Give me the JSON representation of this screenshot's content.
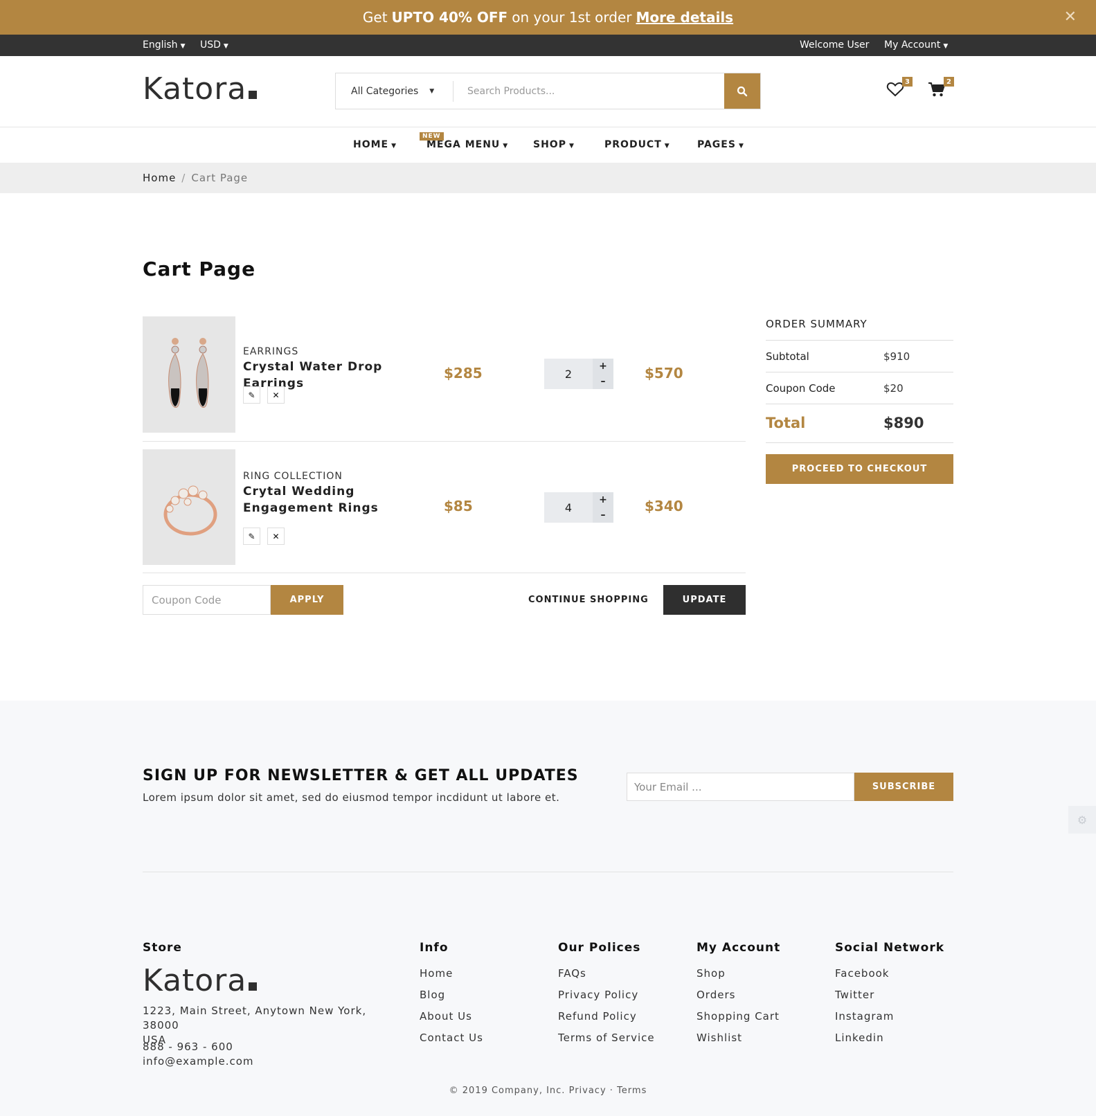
{
  "colors": {
    "accent": "#b38641",
    "dark": "#333333",
    "footer_bg": "#f7f8fa"
  },
  "promo": {
    "text_a": "Get",
    "bold": "UPTO 40% OFF",
    "text_b": "on your 1st order",
    "link": "More details",
    "close_icon": "close-icon"
  },
  "topbar": {
    "language": "English",
    "currency": "USD",
    "welcome": "Welcome User",
    "account": "My Account"
  },
  "header": {
    "logo": "Katora",
    "category": "All Categories",
    "search_placeholder": "Search Products...",
    "wishlist_count": "3",
    "cart_count": "2"
  },
  "nav": {
    "items": [
      "HOME",
      "MEGA MENU",
      "SHOP",
      "PRODUCT",
      "PAGES"
    ],
    "new_tag": "NEW"
  },
  "breadcrumb": {
    "home": "Home",
    "separator": "/",
    "current": "Cart Page"
  },
  "cart": {
    "title": "Cart Page",
    "items": [
      {
        "category": "EARRINGS",
        "name": "Crystal Water Drop Earrings",
        "price": "$285",
        "qty": "2",
        "total": "$570"
      },
      {
        "category": "RING COLLECTION",
        "name": "Crytal Wedding Engagement Rings",
        "price": "$85",
        "qty": "4",
        "total": "$340"
      }
    ],
    "qty_plus": "+",
    "qty_minus": "–",
    "coupon_placeholder": "Coupon Code",
    "apply": "APPLY",
    "continue": "CONTINUE SHOPPING",
    "update": "UPDATE"
  },
  "summary": {
    "title": "ORDER SUMMARY",
    "subtotal_label": "Subtotal",
    "subtotal": "$910",
    "coupon_label": "Coupon Code",
    "coupon": "$20",
    "total_label": "Total",
    "total": "$890",
    "checkout": "PROCEED TO CHECKOUT"
  },
  "newsletter": {
    "title": "SIGN UP FOR NEWSLETTER & GET ALL UPDATES",
    "text": "Lorem ipsum dolor sit amet, sed do eiusmod tempor incdidunt ut labore et.",
    "placeholder": "Your Email ...",
    "button": "SUBSCRIBE"
  },
  "footer": {
    "store": {
      "heading": "Store",
      "logo": "Katora",
      "address_1": "1223, Main Street, Anytown New York, 38000",
      "address_2": "USA",
      "phone": "888 - 963 - 600",
      "email": "info@example.com"
    },
    "info": {
      "heading": "Info",
      "links": [
        "Home",
        "Blog",
        "About Us",
        "Contact Us"
      ]
    },
    "policies": {
      "heading": "Our Polices",
      "links": [
        "FAQs",
        "Privacy Policy",
        "Refund Policy",
        "Terms of Service"
      ]
    },
    "account": {
      "heading": "My Account",
      "links": [
        "Shop",
        "Orders",
        "Shopping Cart",
        "Wishlist"
      ]
    },
    "social": {
      "heading": "Social Network",
      "links": [
        "Facebook",
        "Twitter",
        "Instagram",
        "Linkedin"
      ]
    },
    "copyright": "© 2019 Company, Inc.",
    "privacy": "Privacy",
    "dot": "·",
    "terms": "Terms"
  }
}
